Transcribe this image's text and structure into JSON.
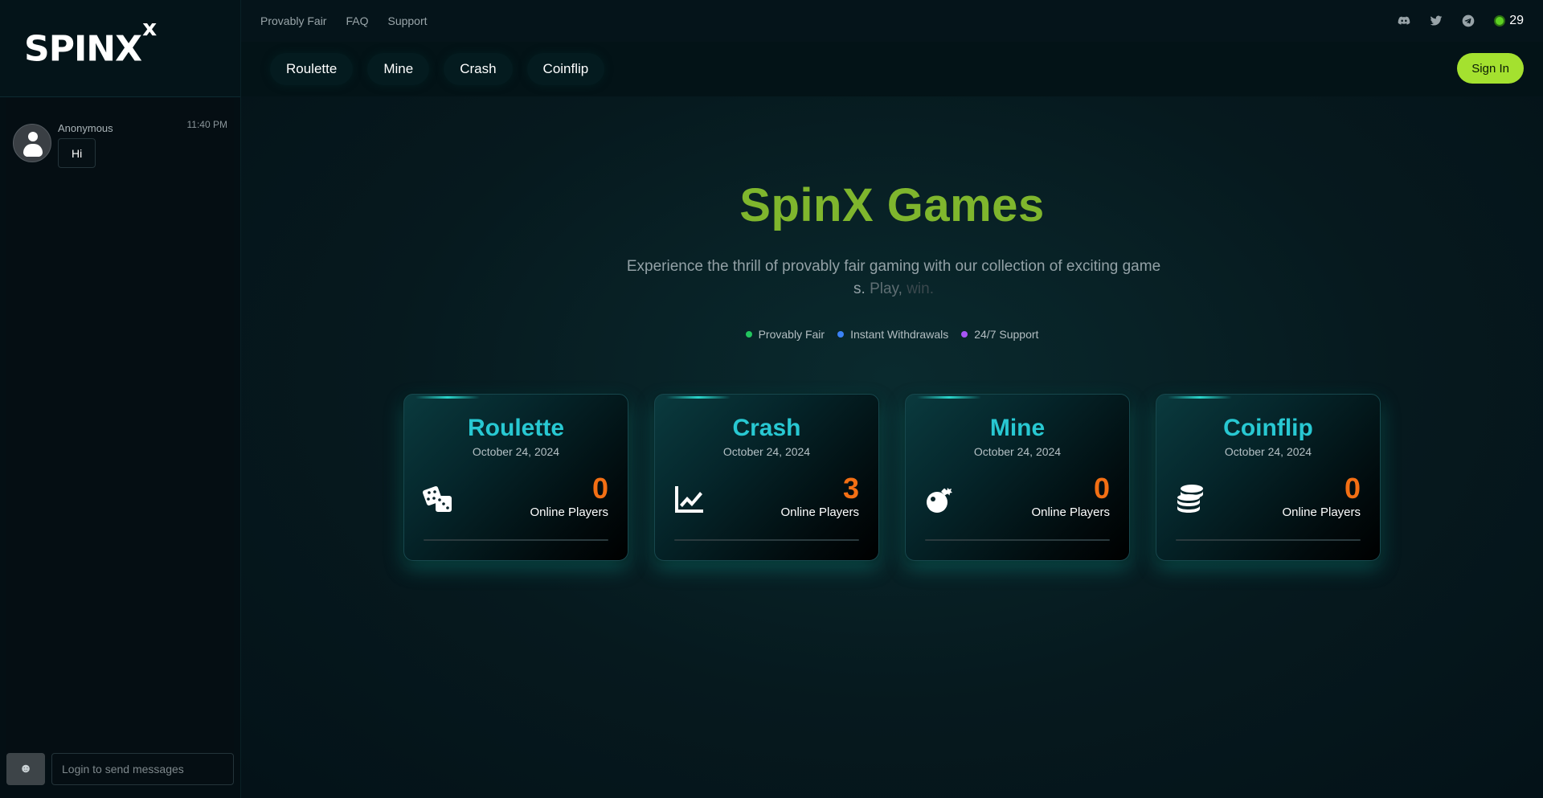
{
  "brand": {
    "logo_text": "SPINX",
    "logo_mark": "x"
  },
  "topbar": {
    "links": [
      "Provably Fair",
      "FAQ",
      "Support"
    ],
    "socials": [
      "discord-icon",
      "twitter-icon",
      "telegram-icon"
    ],
    "online_count": "29",
    "online_color": "#5ed022"
  },
  "nav": {
    "tabs": [
      "Roulette",
      "Mine",
      "Crash",
      "Coinflip"
    ],
    "signin_label": "Sign In",
    "accent": "#a4e12f"
  },
  "chat": {
    "messages": [
      {
        "user": "Anonymous",
        "time": "11:40 PM",
        "text": "Hi"
      }
    ],
    "emoji_icon": "smiley-icon",
    "input_placeholder": "Login to send messages"
  },
  "hero": {
    "title": "SpinX Games",
    "subtitle_main": "Experience the thrill of provably fair gaming with our collection of exciting games.",
    "subtitle_fade1": " Play, ",
    "subtitle_fade2": "win.",
    "features": [
      {
        "label": "Provably Fair",
        "color": "#22c55e"
      },
      {
        "label": "Instant Withdrawals",
        "color": "#3b82f6"
      },
      {
        "label": "24/7 Support",
        "color": "#a855f7"
      }
    ]
  },
  "games": [
    {
      "title": "Roulette",
      "date": "October 24, 2024",
      "count": "0",
      "label": "Online Players",
      "icon": "dice-icon"
    },
    {
      "title": "Crash",
      "date": "October 24, 2024",
      "count": "3",
      "label": "Online Players",
      "icon": "chart-line-icon"
    },
    {
      "title": "Mine",
      "date": "October 24, 2024",
      "count": "0",
      "label": "Online Players",
      "icon": "bomb-icon"
    },
    {
      "title": "Coinflip",
      "date": "October 24, 2024",
      "count": "0",
      "label": "Online Players",
      "icon": "coins-icon"
    }
  ]
}
